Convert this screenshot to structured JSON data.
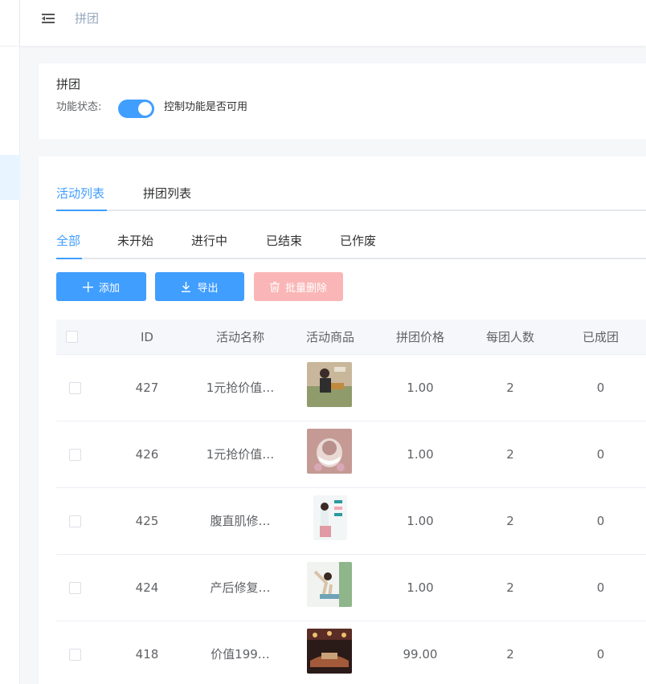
{
  "breadcrumb": {
    "current": "拼团"
  },
  "feature": {
    "title": "拼团",
    "status_label": "功能状态:",
    "status_on": true,
    "status_desc": "控制功能是否可用"
  },
  "tabs": [
    {
      "label": "活动列表",
      "active": true
    },
    {
      "label": "拼团列表",
      "active": false
    }
  ],
  "subtabs": [
    {
      "label": "全部",
      "active": true
    },
    {
      "label": "未开始",
      "active": false
    },
    {
      "label": "进行中",
      "active": false
    },
    {
      "label": "已结束",
      "active": false
    },
    {
      "label": "已作废",
      "active": false
    }
  ],
  "toolbar": {
    "add_label": "添加",
    "export_label": "导出",
    "batch_delete_label": "批量删除"
  },
  "table": {
    "columns": [
      "ID",
      "活动名称",
      "活动商品",
      "拼团价格",
      "每团人数",
      "已成团"
    ],
    "rows": [
      {
        "id": "427",
        "name": "1元抢价值…",
        "price": "1.00",
        "per_group": "2",
        "formed": "0"
      },
      {
        "id": "426",
        "name": "1元抢价值…",
        "price": "1.00",
        "per_group": "2",
        "formed": "0"
      },
      {
        "id": "425",
        "name": "腹直肌修…",
        "price": "1.00",
        "per_group": "2",
        "formed": "0"
      },
      {
        "id": "424",
        "name": "产后修复…",
        "price": "1.00",
        "per_group": "2",
        "formed": "0"
      },
      {
        "id": "418",
        "name": "价值199…",
        "price": "99.00",
        "per_group": "2",
        "formed": "0"
      }
    ]
  },
  "colors": {
    "primary": "#409eff",
    "danger_disabled": "#fab6b6",
    "sidebar_active": "#e8f4ff"
  }
}
